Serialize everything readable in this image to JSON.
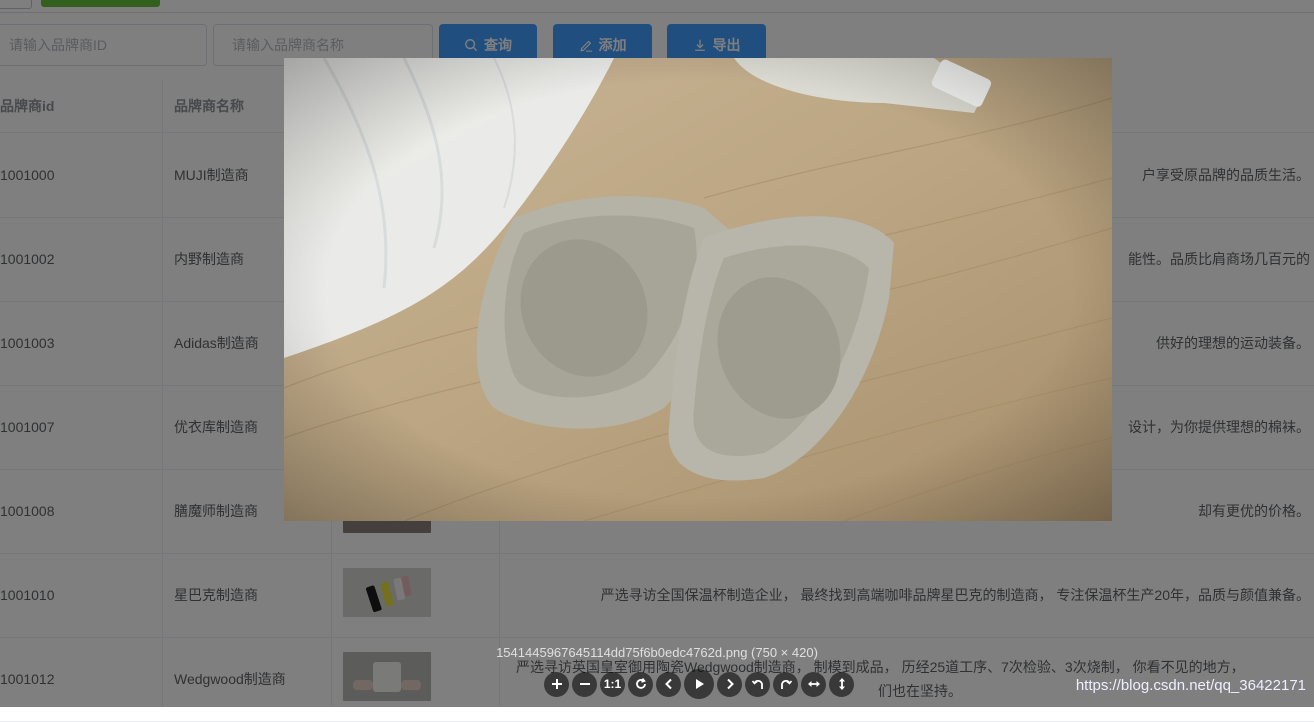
{
  "search": {
    "id_placeholder": "请输入品牌商ID",
    "name_placeholder": "请输入品牌商名称",
    "query_label": "查询",
    "add_label": "添加",
    "export_label": "导出"
  },
  "table": {
    "headers": {
      "id": "品牌商id",
      "name": "品牌商名称"
    },
    "rows": [
      {
        "id": "1001000",
        "name": "MUJI制造商",
        "desc": "户享受原品牌的品质生活。"
      },
      {
        "id": "1001002",
        "name": "内野制造商",
        "desc": "能性。品质比肩商场几百元的"
      },
      {
        "id": "1001003",
        "name": "Adidas制造商",
        "desc": "供好的理想的运动装备。"
      },
      {
        "id": "1001007",
        "name": "优衣库制造商",
        "desc": "设计，为你提供理想的棉袜。"
      },
      {
        "id": "1001008",
        "name": "膳魔师制造商",
        "desc": "却有更优的价格。"
      },
      {
        "id": "1001010",
        "name": "星巴克制造商",
        "desc": "严选寻访全国保温杯制造企业， 最终找到高端咖啡品牌星巴克的制造商， 专注保温杯生产20年，品质与颜值兼备。"
      },
      {
        "id": "1001012",
        "name": "Wedgwood制造商",
        "desc_line1": "严选寻访英国皇室御用陶瓷Wedgwood制造商， 制模到成品， 历经25道工序、7次检验、3次烧制， 你看不见的地方，",
        "desc_line2": "们也在坚持。"
      }
    ]
  },
  "viewer": {
    "title": "1541445967645114dd75f6b0edc4762d.png (750 × 420)",
    "tools": [
      "zoom-in",
      "zoom-out",
      "one-to-one",
      "reset",
      "prev",
      "play",
      "next",
      "rotate-left",
      "rotate-right",
      "flip-horizontal",
      "flip-vertical"
    ],
    "one_to_one_label": "1:1"
  },
  "watermark": "https://blog.csdn.net/qq_36422171",
  "colors": {
    "primary": "#409eff",
    "success": "#67c23a",
    "mask": "rgba(0,0,0,0.5)"
  }
}
